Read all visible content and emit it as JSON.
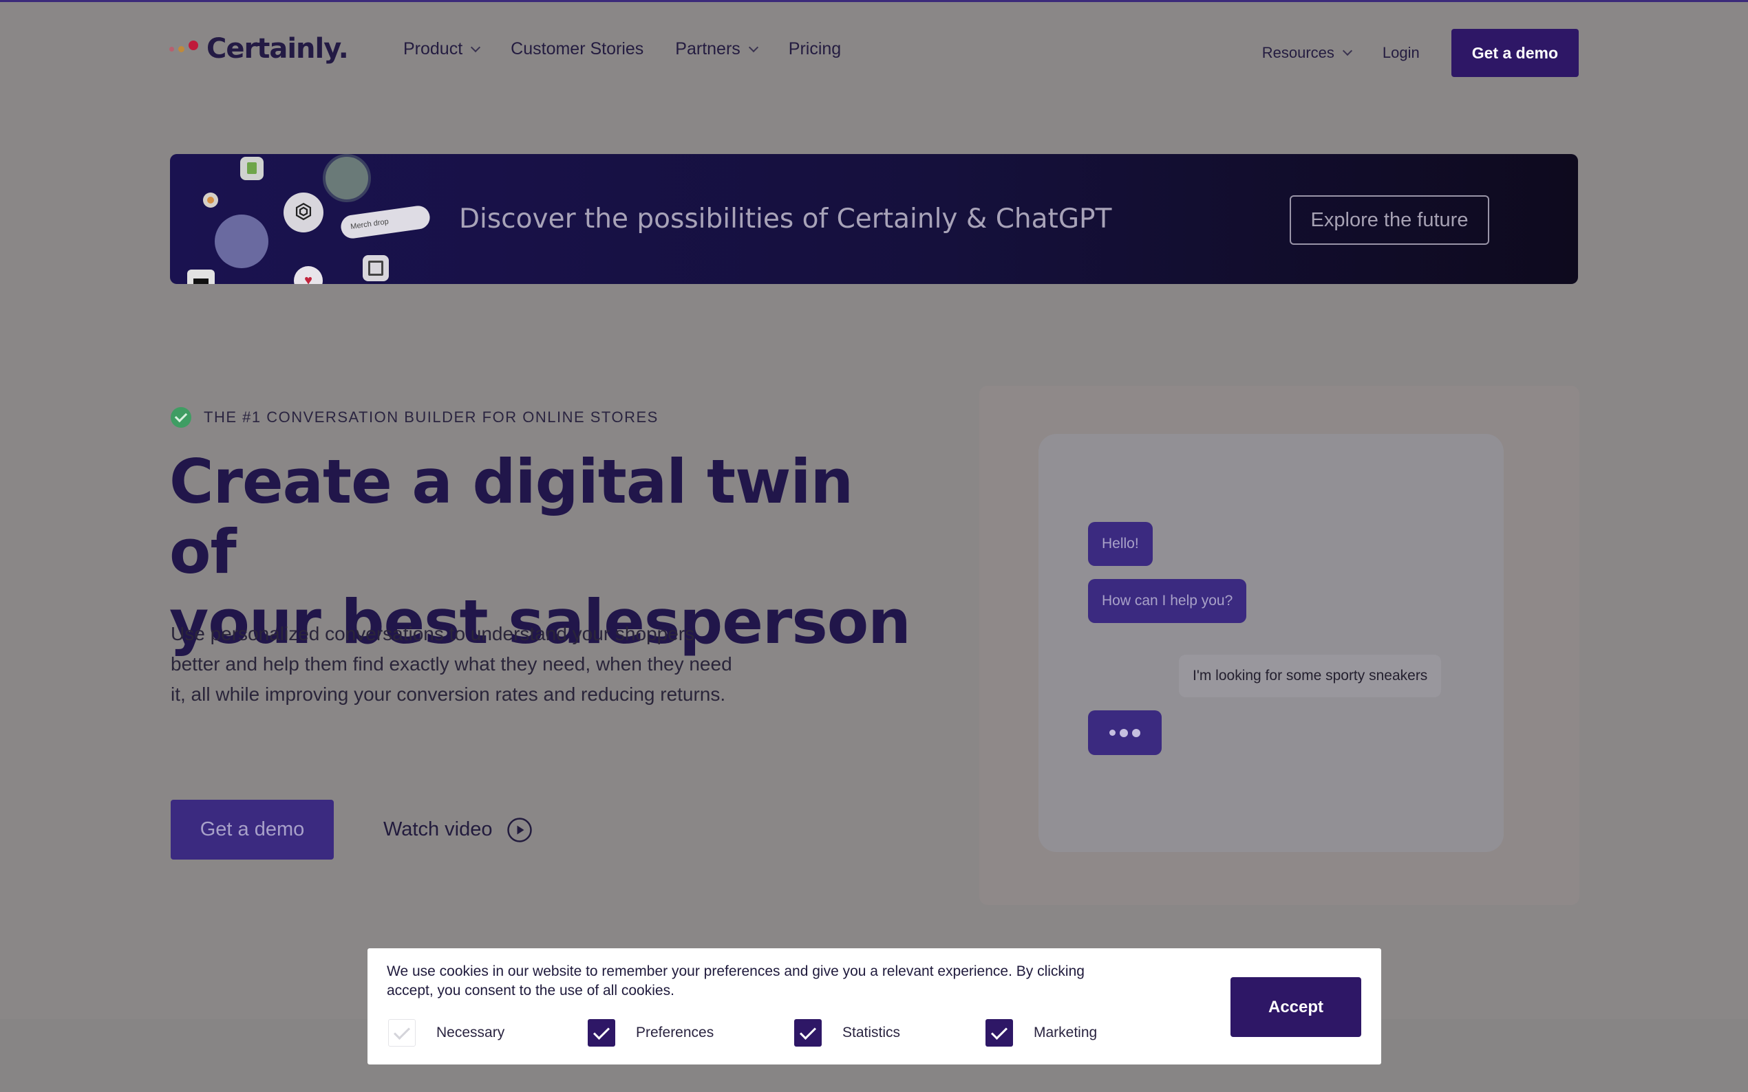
{
  "header": {
    "logo_text": "Certainly.",
    "nav": [
      {
        "label": "Product",
        "has_dropdown": true
      },
      {
        "label": "Customer Stories",
        "has_dropdown": false
      },
      {
        "label": "Partners",
        "has_dropdown": true
      },
      {
        "label": "Pricing",
        "has_dropdown": false
      }
    ],
    "resources_label": "Resources",
    "login_label": "Login",
    "demo_label": "Get a demo"
  },
  "banner": {
    "text": "Discover the possibilities of Certainly & ChatGPT",
    "button_label": "Explore the future",
    "pill_text": "Merch drop"
  },
  "hero": {
    "tagline": "THE #1 CONVERSATION BUILDER FOR ONLINE STORES",
    "title_line1": "Create a digital twin of",
    "title_line2": "your best salesperson",
    "description": "Use personalized conversations to understand your shoppers better and help them find exactly what they need, when they need it, all while improving your conversion rates and reducing returns.",
    "cta_demo": "Get a demo",
    "cta_watch": "Watch video"
  },
  "chat": {
    "messages": [
      {
        "from": "bot",
        "text": "Hello!"
      },
      {
        "from": "bot",
        "text": "How can I help you?"
      },
      {
        "from": "user",
        "text": "I'm looking for some sporty sneakers"
      }
    ]
  },
  "cookie": {
    "text": "We use cookies in our website to remember your preferences and give you a relevant experience. By clicking accept, you consent to the use of all cookies.",
    "options": [
      {
        "label": "Necessary",
        "checked": false
      },
      {
        "label": "Preferences",
        "checked": true
      },
      {
        "label": "Statistics",
        "checked": true
      },
      {
        "label": "Marketing",
        "checked": true
      }
    ],
    "accept_label": "Accept"
  },
  "colors": {
    "brand_purple": "#2e1766",
    "accent_green": "#3f9d63",
    "logo_red": "#c01a3a"
  }
}
